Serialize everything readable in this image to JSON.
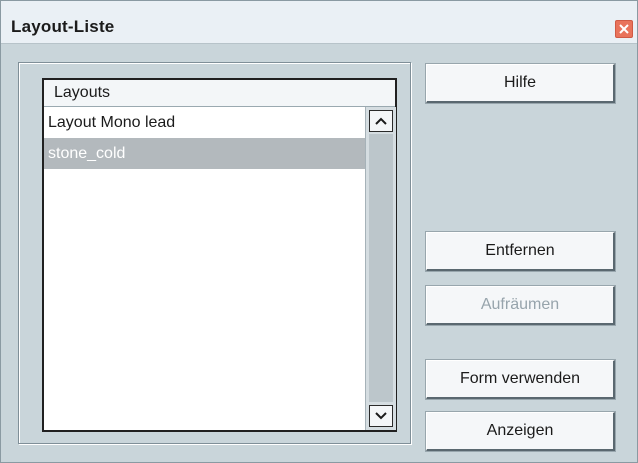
{
  "window": {
    "title": "Layout-Liste"
  },
  "layouts_list": {
    "header": "Layouts",
    "items": [
      {
        "label": "Layout Mono lead",
        "selected": false
      },
      {
        "label": "stone_cold",
        "selected": true
      }
    ]
  },
  "buttons": {
    "help": "Hilfe",
    "remove": "Entfernen",
    "cleanup": "Aufräumen",
    "use_form": "Form verwenden",
    "show": "Anzeigen"
  },
  "icons": {
    "close": "close-icon",
    "scroll_up": "arrow-up-icon",
    "scroll_down": "arrow-down-icon"
  },
  "colors": {
    "dialog_background": "#c9d5da",
    "selection": "#b3b9bd",
    "close_button": "#e9735b",
    "disabled_text": "#97a4ac"
  }
}
